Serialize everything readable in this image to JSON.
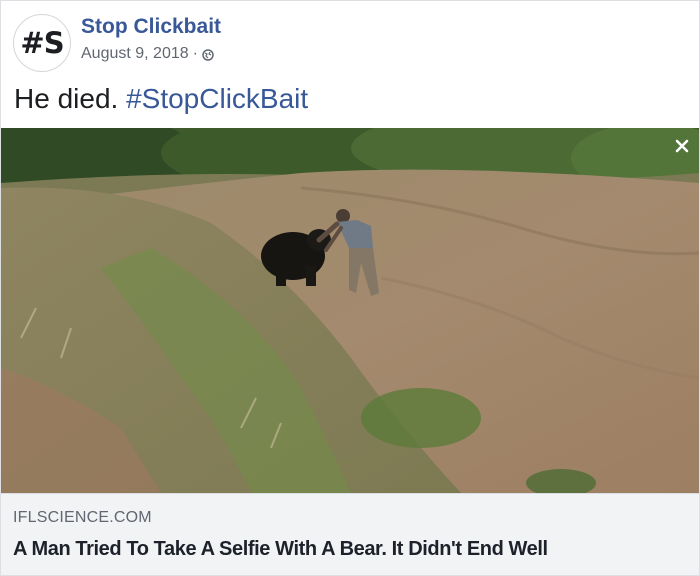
{
  "post": {
    "avatar_text": "#S",
    "page_name": "Stop Clickbait",
    "date": "August 9, 2018",
    "separator": "·",
    "privacy_icon": "globe-icon",
    "text": "He died.",
    "hashtag": "#StopClickBait"
  },
  "media": {
    "close_icon": "close-icon",
    "close_label": "×"
  },
  "link_preview": {
    "domain": "IFLSCIENCE.COM",
    "title": "A Man Tried To Take A Selfie With A Bear. It Didn't End Well"
  },
  "colors": {
    "link_blue": "#385898",
    "meta_gray": "#616770",
    "preview_bg": "#f2f3f5"
  }
}
